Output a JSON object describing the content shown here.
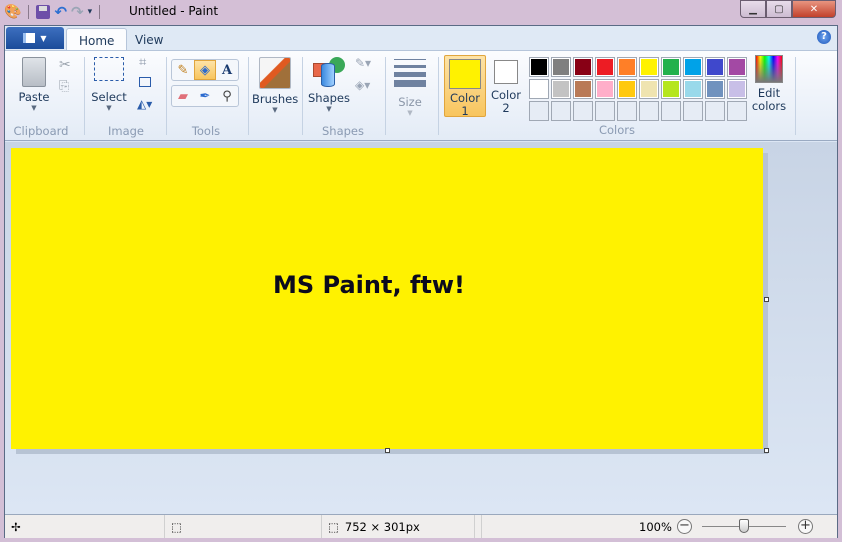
{
  "window": {
    "title": "Untitled - Paint",
    "controls": [
      "minimize",
      "maximize",
      "close"
    ]
  },
  "quick_access": [
    "paint-app-icon",
    "save-icon",
    "undo-icon",
    "redo-icon",
    "customize-dropdown-icon"
  ],
  "tabs": [
    {
      "label": "Home",
      "active": true
    },
    {
      "label": "View",
      "active": false
    }
  ],
  "help_glyph": "?",
  "ribbon": {
    "clipboard": {
      "label": "Clipboard",
      "paste": "Paste"
    },
    "image": {
      "label": "Image",
      "select": "Select"
    },
    "tools": {
      "label": "Tools",
      "selected_tool": "fill"
    },
    "brushes": {
      "label": "Brushes"
    },
    "shapes": {
      "label": "Shapes",
      "button": "Shapes"
    },
    "size": {
      "label": "Size"
    },
    "colors": {
      "label": "Colors",
      "color1_label": "Color",
      "color1_num": "1",
      "color2_label": "Color",
      "color2_num": "2",
      "color1_value": "#fff200",
      "color2_value": "#ffffff",
      "edit_line1": "Edit",
      "edit_line2": "colors",
      "palette_row1": [
        "#000000",
        "#7f7f7f",
        "#880015",
        "#ed1c24",
        "#ff7f27",
        "#fff200",
        "#22b14c",
        "#00a2e8",
        "#3f48cc",
        "#a349a4"
      ],
      "palette_row2": [
        "#ffffff",
        "#c3c3c3",
        "#b97a57",
        "#ffaec9",
        "#ffc90e",
        "#efe4b0",
        "#b5e61d",
        "#99d9ea",
        "#7092be",
        "#c8bfe7"
      ]
    }
  },
  "canvas": {
    "text": "MS Paint, ftw!",
    "background": "#fff200"
  },
  "status": {
    "dimensions": "752 × 301px",
    "zoom": "100%",
    "zoom_level_percent": 100
  }
}
